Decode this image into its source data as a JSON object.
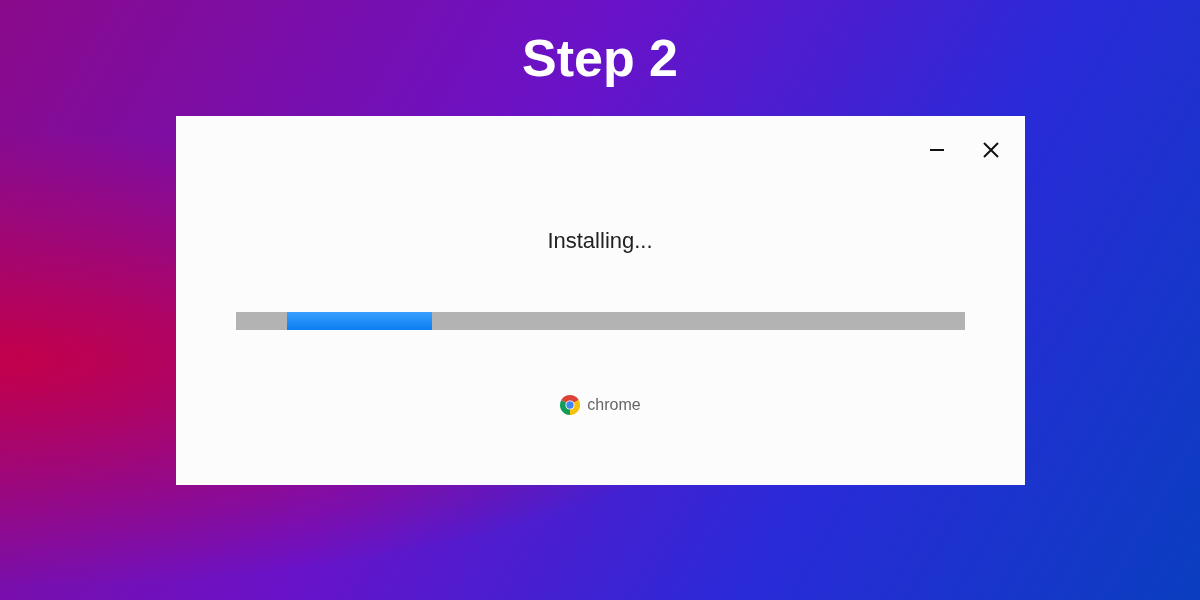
{
  "heading": "Step 2",
  "window": {
    "status": "Installing...",
    "progress": {
      "level": 0.2
    },
    "brand": "chrome"
  }
}
